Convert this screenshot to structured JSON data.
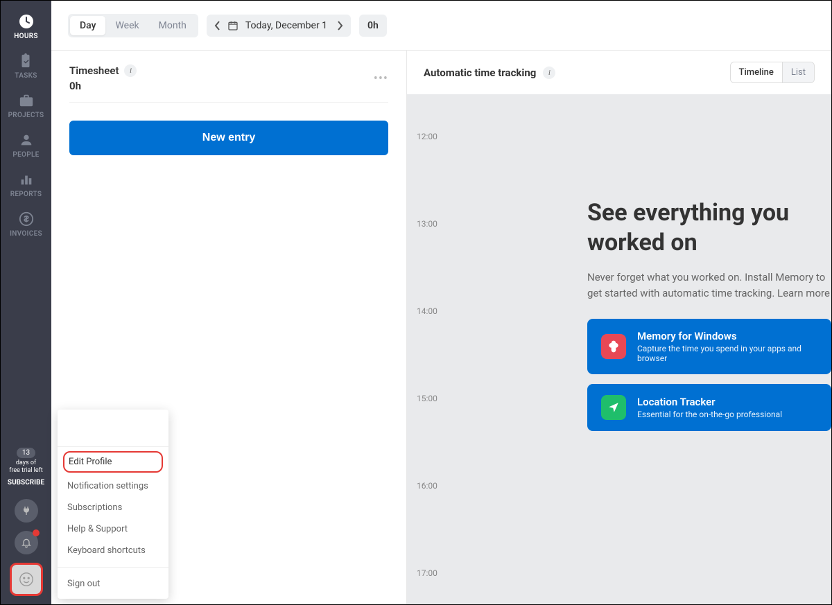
{
  "sidebar": {
    "items": [
      {
        "label": "HOURS"
      },
      {
        "label": "TASKS"
      },
      {
        "label": "PROJECTS"
      },
      {
        "label": "PEOPLE"
      },
      {
        "label": "REPORTS"
      },
      {
        "label": "INVOICES"
      }
    ],
    "trial": {
      "days": "13",
      "text1": "days of",
      "text2": "free trial left"
    },
    "subscribe": "SUBSCRIBE"
  },
  "toolbar": {
    "views": {
      "day": "Day",
      "week": "Week",
      "month": "Month"
    },
    "date": "Today, December 1",
    "total": "0h"
  },
  "timesheet": {
    "title": "Timesheet",
    "hours": "0h",
    "new_entry": "New entry"
  },
  "tracking": {
    "title": "Automatic time tracking",
    "views": {
      "timeline": "Timeline",
      "list": "List"
    },
    "times": [
      "12:00",
      "13:00",
      "14:00",
      "15:00",
      "16:00",
      "17:00"
    ],
    "promo": {
      "heading": "See everything you worked on",
      "sub": "Never forget what you worked on. Install Memory to get started with automatic time tracking. Learn more",
      "cards": [
        {
          "title": "Memory for Windows",
          "sub": "Capture the time you spend in your apps and browser"
        },
        {
          "title": "Location Tracker",
          "sub": "Essential for the on-the-go professional"
        }
      ]
    }
  },
  "profile_menu": {
    "items": [
      "Edit Profile",
      "Notification settings",
      "Subscriptions",
      "Help & Support",
      "Keyboard shortcuts"
    ],
    "signout": "Sign out"
  }
}
